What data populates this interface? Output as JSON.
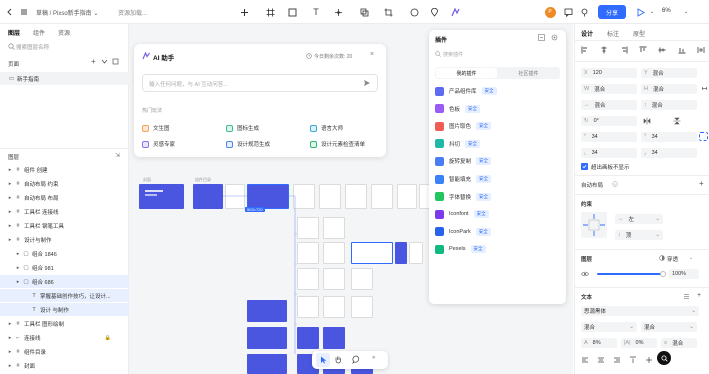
{
  "topbar": {
    "breadcrumb": "草稿 / Pixso新手指南 ⌄",
    "loading": "资源加载...",
    "share_label": "分享",
    "zoom": "6%"
  },
  "left": {
    "tabs": [
      "图层",
      "组件",
      "资源"
    ],
    "search_placeholder": "搜索图层名称",
    "pages_title": "页面",
    "page_item": "新手指南",
    "layers_title": "图层",
    "layers": [
      {
        "label": "组件 创建",
        "indent": 0,
        "icon": "#",
        "selected": false
      },
      {
        "label": "自动布局 约束",
        "indent": 0,
        "icon": "#",
        "selected": false
      },
      {
        "label": "自动布局 布局",
        "indent": 0,
        "icon": "#",
        "selected": false
      },
      {
        "label": "工具栏 连接线",
        "indent": 0,
        "icon": "#",
        "selected": false
      },
      {
        "label": "工具栏 钢笔工具",
        "indent": 0,
        "icon": "#",
        "selected": false
      },
      {
        "label": "设计与制作",
        "indent": 0,
        "icon": "#",
        "selected": false
      },
      {
        "label": "组合 1846",
        "indent": 1,
        "icon": "▢",
        "selected": false
      },
      {
        "label": "组合 981",
        "indent": 1,
        "icon": "▢",
        "selected": false
      },
      {
        "label": "组合 686",
        "indent": 1,
        "icon": "▢",
        "selected": true
      },
      {
        "label": "掌握基础创作技巧，让设计...",
        "indent": 2,
        "icon": "T",
        "selected": true
      },
      {
        "label": "设计 与制作",
        "indent": 2,
        "icon": "T",
        "selected": true
      },
      {
        "label": "工具栏 图形绘制",
        "indent": 0,
        "icon": "#",
        "selected": false
      },
      {
        "label": "连接线",
        "indent": 0,
        "icon": "⌐",
        "selected": false
      },
      {
        "label": "组件目录",
        "indent": 0,
        "icon": "#",
        "selected": false
      },
      {
        "label": "封面",
        "indent": 0,
        "icon": "#",
        "selected": false
      }
    ]
  },
  "canvas": {
    "cover_label": "封面",
    "guide_label": "组件目录",
    "size_badge": "503×720"
  },
  "ai": {
    "title": "AI 助手",
    "quota": "今日剩余次数: 20",
    "placeholder": "输入任何问题，与 AI 互动问答...",
    "hot_title": "热门玩法",
    "items": [
      "文生图",
      "图标生成",
      "语言大师",
      "灵感专家",
      "设计规范生成",
      "设计元素检查清单"
    ]
  },
  "plugins": {
    "title": "插件",
    "search_placeholder": "搜索插件",
    "tabs": [
      "我的插件",
      "社区插件"
    ],
    "badge": "安全",
    "items": [
      {
        "name": "产品组件库",
        "color": "#5b6cf0"
      },
      {
        "name": "色板",
        "color": "#9b5cf6"
      },
      {
        "name": "图片取色",
        "color": "#f25c54"
      },
      {
        "name": "抖切",
        "color": "#20b8a6"
      },
      {
        "name": "旋转复制",
        "color": "#4a7cf6"
      },
      {
        "name": "智能填充",
        "color": "#3b82f6"
      },
      {
        "name": "字体替换",
        "color": "#22c55e"
      },
      {
        "name": "Iconfont",
        "color": "#7c3aed"
      },
      {
        "name": "IconPark",
        "color": "#2563eb"
      },
      {
        "name": "Pexels",
        "color": "#10b981"
      }
    ]
  },
  "right": {
    "tabs": [
      "设计",
      "标注",
      "原型"
    ],
    "x": "120",
    "y": "混合",
    "w": "混合",
    "h": "混合",
    "rot": "0°",
    "radius": [
      "34",
      "34",
      "34",
      "34"
    ],
    "clip_label": "超出画板不显示",
    "autolayout": "自动布局",
    "constraint_title": "约束",
    "constraint_h": "左",
    "constraint_v": "顶",
    "layer_title": "图层",
    "blend": "穿透",
    "opacity": "100%",
    "text_title": "文本",
    "font": "思源黑体",
    "weight": "混合",
    "size": "混合",
    "line": "8%",
    "letter": "0%",
    "para": "混合"
  }
}
